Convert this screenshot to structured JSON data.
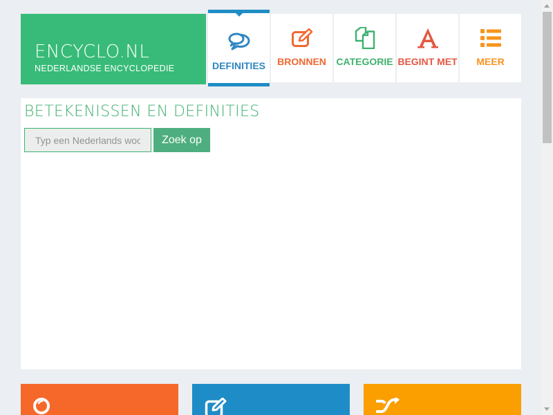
{
  "logo": {
    "name": "ENCYCLO.NL",
    "tagline": "NEDERLANDSE ENCYCLOPEDIE"
  },
  "nav": {
    "items": [
      {
        "label": "DEFINITIES",
        "icon": "comments-icon",
        "color": "#2f86c2",
        "active": true
      },
      {
        "label": "BRONNEN",
        "icon": "edit-icon",
        "color": "#f06830"
      },
      {
        "label": "CATEGORIE",
        "icon": "copy-icon",
        "color": "#3fb16f"
      },
      {
        "label": "BEGINT MET",
        "icon": "letter-a-icon",
        "color": "#e35742"
      },
      {
        "label": "MEER",
        "icon": "list-icon",
        "color": "#f7941e"
      }
    ]
  },
  "main": {
    "heading": "BETEKENISSEN EN DEFINITIES",
    "search": {
      "placeholder": "Typ een Nederlands woord",
      "value": "",
      "button_label": "Zoek op"
    }
  },
  "tiles": [
    {
      "icon": "lightbulb-icon",
      "color": "#f5682a"
    },
    {
      "icon": "edit-icon",
      "color": "#1e8cc6"
    },
    {
      "icon": "shuffle-icon",
      "color": "#fb9f00"
    }
  ],
  "colors": {
    "page_bg": "#ebeef2",
    "logo_bg": "#38bb78",
    "accent_green": "#3fb16f",
    "active_blue": "#1f8dc6"
  }
}
